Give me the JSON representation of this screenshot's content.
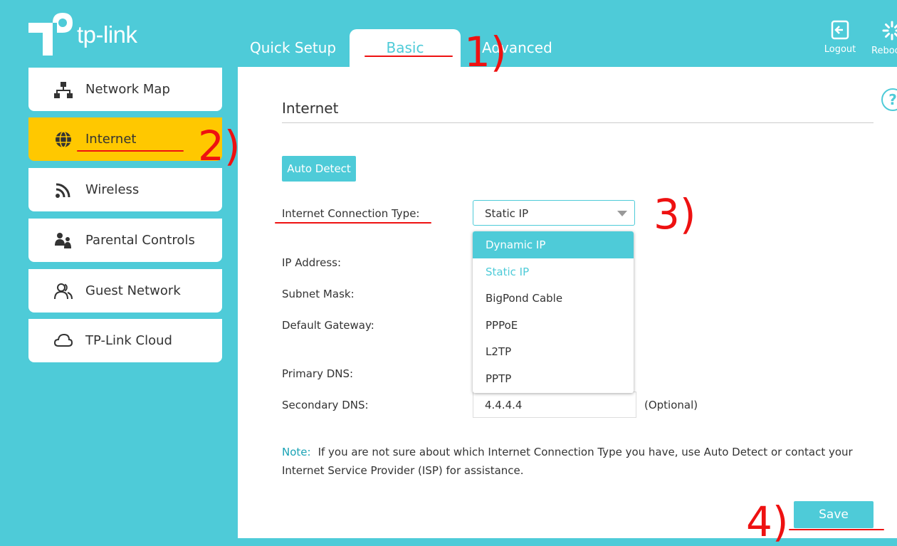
{
  "brand": {
    "name": "tp-link",
    "accent": "#4ecbd8",
    "active": "#ffc800",
    "annotation": "#ee1111"
  },
  "topnav": {
    "tabs": [
      {
        "label": "Quick Setup",
        "active": false
      },
      {
        "label": "Basic",
        "active": true
      },
      {
        "label": "Advanced",
        "active": false
      }
    ],
    "logout_label": "Logout",
    "reboot_label": "Reboot"
  },
  "sidebar": {
    "items": [
      {
        "label": "Network Map",
        "icon": "network-map-icon",
        "active": false
      },
      {
        "label": "Internet",
        "icon": "globe-icon",
        "active": true
      },
      {
        "label": "Wireless",
        "icon": "wifi-icon",
        "active": false
      },
      {
        "label": "Parental Controls",
        "icon": "parental-controls-icon",
        "active": false
      },
      {
        "label": "Guest Network",
        "icon": "guest-users-icon",
        "active": false
      },
      {
        "label": "TP-Link Cloud",
        "icon": "cloud-icon",
        "active": false
      }
    ]
  },
  "main": {
    "title": "Internet",
    "auto_detect_label": "Auto Detect",
    "help_icon": "?",
    "connection_type_label": "Internet Connection Type:",
    "connection_type_value": "Static IP",
    "connection_type_options": [
      "Dynamic IP",
      "Static IP",
      "BigPond Cable",
      "PPPoE",
      "L2TP",
      "PPTP"
    ],
    "fields": {
      "ip_address_label": "IP Address:",
      "subnet_mask_label": "Subnet Mask:",
      "default_gateway_label": "Default Gateway:",
      "primary_dns_label": "Primary DNS:",
      "secondary_dns_label": "Secondary DNS:",
      "secondary_dns_value": "4.4.4.4",
      "optional_label": "(Optional)"
    },
    "note_label": "Note:",
    "note_text": "If you are not sure about which Internet Connection Type you have, use Auto Detect or contact your Internet Service Provider (ISP) for assistance.",
    "save_label": "Save"
  },
  "annotations": [
    "1)",
    "2)",
    "3)",
    "4)"
  ]
}
